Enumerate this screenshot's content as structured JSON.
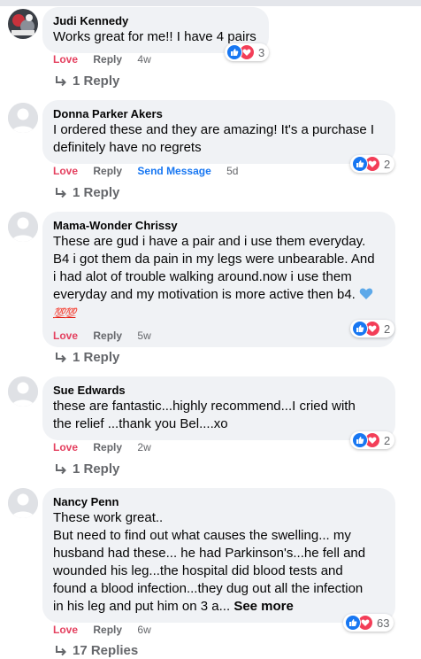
{
  "comments": [
    {
      "name": "Judi Kennedy",
      "text": "Works great for me!! I have 4 pairs",
      "love": "Love",
      "reply": "Reply",
      "time": "4w",
      "reactions": "3",
      "replies": "1 Reply",
      "avatar": "photo"
    },
    {
      "name": "Donna Parker Akers",
      "text": "I ordered these and they are amazing! It's a purchase I\ndefinitely have no regrets",
      "love": "Love",
      "reply": "Reply",
      "send": "Send Message",
      "time": "5d",
      "reactions": "2",
      "replies": "1 Reply"
    },
    {
      "name": "Mama-Wonder Chrissy",
      "text": "These are gud i have a pair and i use them everyday.\nB4 i got them da pain in my legs were unbearable. And\ni had alot of trouble walking around.now i use them\neveryday and my motivation is more active then b4.",
      "emoji": "💯💯",
      "love": "Love",
      "reply": "Reply",
      "time": "5w",
      "reactions": "2",
      "replies": "1 Reply"
    },
    {
      "name": "Sue Edwards",
      "text": "these are fantastic...highly recommend...I cried with\nthe relief ...thank you Bel....xo",
      "love": "Love",
      "reply": "Reply",
      "time": "2w",
      "reactions": "2",
      "replies": "1 Reply"
    },
    {
      "name": "Nancy Penn",
      "text": "These work great..\nBut need to find out what causes the swelling... my\nhusband had these... he had Parkinson's...he fell and\nwounded his leg...the hospital did blood tests and\nfound a blood infection...they dug out all the infection\nin his leg and put him on 3 a...",
      "see_more": "See more",
      "love": "Love",
      "reply": "Reply",
      "time": "6w",
      "reactions": "63",
      "replies": "17 Replies"
    }
  ],
  "colors": {
    "love": "#e4405f",
    "link": "#1877f2",
    "meta": "#65676b",
    "bubble": "#f0f2f5"
  }
}
